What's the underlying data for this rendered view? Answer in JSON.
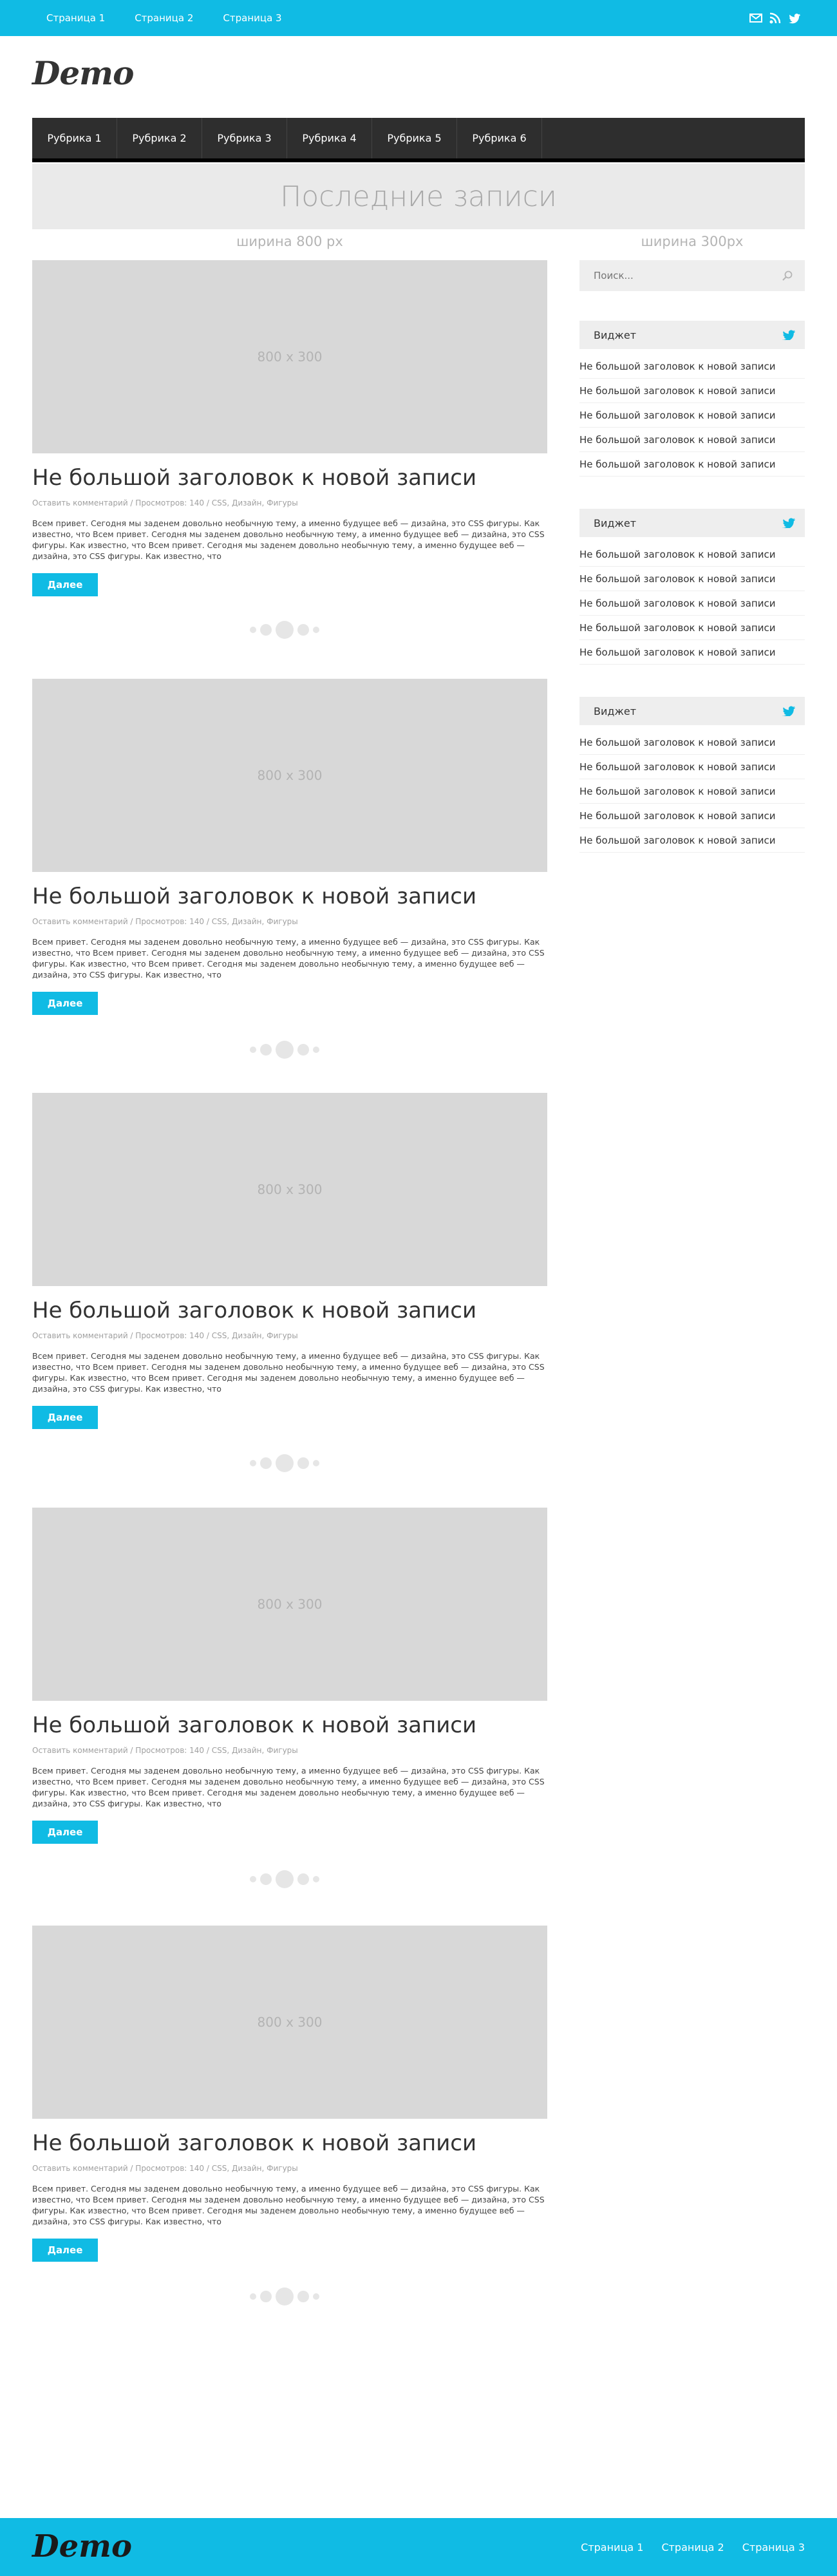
{
  "topbar": {
    "pages": [
      "Страница 1",
      "Страница 2",
      "Страница 3"
    ],
    "icons": [
      "mail-icon",
      "rss-icon",
      "twitter-icon"
    ],
    "color": "#10bbe4"
  },
  "logo": "Demo",
  "nav": {
    "items": [
      "Рубрика 1",
      "Рубрика 2",
      "Рубрика 3",
      "Рубрика 4",
      "Рубрика 5",
      "Рубрика 6"
    ]
  },
  "band": {
    "title": "Последние записи"
  },
  "labels": {
    "main_width": "ширина 800 px",
    "side_width": "ширина 300px"
  },
  "posts": [
    {
      "thumb": "800 x 300",
      "title": "Не большой заголовок к новой записи",
      "meta": "Оставить комментарий / Просмотров: 140 / CSS, Дизайн, Фигуры",
      "excerpt": "Всем привет. Сегодня мы заденем довольно необычную тему, а именно будущее веб — дизайна, это CSS фигуры. Как известно, что Всем привет. Сегодня мы заденем довольно необычную тему, а именно будущее веб — дизайна, это CSS фигуры. Как известно, что Всем привет. Сегодня мы заденем довольно необычную тему, а именно будущее веб — дизайна, это CSS фигуры. Как известно, что",
      "more": "Далее"
    },
    {
      "thumb": "800 x 300",
      "title": "Не большой заголовок к новой записи",
      "meta": "Оставить комментарий / Просмотров: 140 / CSS, Дизайн, Фигуры",
      "excerpt": "Всем привет. Сегодня мы заденем довольно необычную тему, а именно будущее веб — дизайна, это CSS фигуры. Как известно, что Всем привет. Сегодня мы заденем довольно необычную тему, а именно будущее веб — дизайна, это CSS фигуры. Как известно, что Всем привет. Сегодня мы заденем довольно необычную тему, а именно будущее веб — дизайна, это CSS фигуры. Как известно, что",
      "more": "Далее"
    },
    {
      "thumb": "800 x 300",
      "title": "Не большой заголовок к новой записи",
      "meta": "Оставить комментарий / Просмотров: 140 / CSS, Дизайн, Фигуры",
      "excerpt": "Всем привет. Сегодня мы заденем довольно необычную тему, а именно будущее веб — дизайна, это CSS фигуры. Как известно, что Всем привет. Сегодня мы заденем довольно необычную тему, а именно будущее веб — дизайна, это CSS фигуры. Как известно, что Всем привет. Сегодня мы заденем довольно необычную тему, а именно будущее веб — дизайна, это CSS фигуры. Как известно, что",
      "more": "Далее"
    },
    {
      "thumb": "800 x 300",
      "title": "Не большой заголовок к новой записи",
      "meta": "Оставить комментарий / Просмотров: 140 / CSS, Дизайн, Фигуры",
      "excerpt": "Всем привет. Сегодня мы заденем довольно необычную тему, а именно будущее веб — дизайна, это CSS фигуры. Как известно, что Всем привет. Сегодня мы заденем довольно необычную тему, а именно будущее веб — дизайна, это CSS фигуры. Как известно, что Всем привет. Сегодня мы заденем довольно необычную тему, а именно будущее веб — дизайна, это CSS фигуры. Как известно, что",
      "more": "Далее"
    },
    {
      "thumb": "800 x 300",
      "title": "Не большой заголовок к новой записи",
      "meta": "Оставить комментарий / Просмотров: 140 / CSS, Дизайн, Фигуры",
      "excerpt": "Всем привет. Сегодня мы заденем довольно необычную тему, а именно будущее веб — дизайна, это CSS фигуры. Как известно, что Всем привет. Сегодня мы заденем довольно необычную тему, а именно будущее веб — дизайна, это CSS фигуры. Как известно, что Всем привет. Сегодня мы заденем довольно необычную тему, а именно будущее веб — дизайна, это CSS фигуры. Как известно, что",
      "more": "Далее"
    }
  ],
  "sidebar": {
    "search_placeholder": "Поиск...",
    "widgets": [
      {
        "title": "Виджет",
        "icon": "twitter-icon",
        "items": [
          "Не большой заголовок к новой записи",
          "Не большой заголовок к новой записи",
          "Не большой заголовок к новой записи",
          "Не большой заголовок к новой записи",
          "Не большой заголовок к новой записи"
        ]
      },
      {
        "title": "Виджет",
        "icon": "twitter-icon",
        "items": [
          "Не большой заголовок к новой записи",
          "Не большой заголовок к новой записи",
          "Не большой заголовок к новой записи",
          "Не большой заголовок к новой записи",
          "Не большой заголовок к новой записи"
        ]
      },
      {
        "title": "Виджет",
        "icon": "twitter-icon",
        "items": [
          "Не большой заголовок к новой записи",
          "Не большой заголовок к новой записи",
          "Не большой заголовок к новой записи",
          "Не большой заголовок к новой записи",
          "Не большой заголовок к новой записи"
        ]
      }
    ]
  },
  "footer": {
    "logo": "Demo",
    "pages": [
      "Страница 1",
      "Страница 2",
      "Страница 3"
    ]
  }
}
